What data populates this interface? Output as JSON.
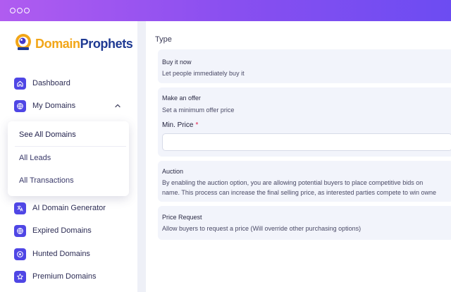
{
  "app": {
    "brand_part1": "Domain",
    "brand_part2": "Prophets"
  },
  "colors": {
    "titlebar_start": "#b05cf0",
    "titlebar_end": "#6c4cf2",
    "accent": "#4f46e5",
    "brand_blue": "#1f3a93",
    "brand_orange": "#f2a618",
    "required": "#e11d48"
  },
  "sidebar": {
    "items": [
      {
        "label": "Dashboard",
        "icon": "home-icon"
      },
      {
        "label": "My Domains",
        "icon": "globe-icon",
        "expanded": true
      },
      {
        "label": "AI Domain Generator",
        "icon": "translate-icon"
      },
      {
        "label": "Expired Domains",
        "icon": "globe-icon"
      },
      {
        "label": "Hunted Domains",
        "icon": "target-icon"
      },
      {
        "label": "Premium Domains",
        "icon": "star-icon"
      }
    ],
    "submenu": [
      {
        "label": "See All Domains",
        "active": true
      },
      {
        "label": "All Leads"
      },
      {
        "label": "All Transactions"
      }
    ]
  },
  "main": {
    "section_title": "Type",
    "options": [
      {
        "title": "Buy it now",
        "desc": "Let people immediately buy it"
      },
      {
        "title": "Make an offer",
        "desc": "Set a minimum offer price"
      },
      {
        "title": "Auction",
        "desc_line1": "By enabling the auction option, you are allowing potential buyers to place competitive bids on",
        "desc_line2": "name. This process can increase the final selling price, as interested parties compete to win owne"
      },
      {
        "title": "Price Request",
        "desc": "Allow buyers to request a price (Will override other purchasing options)"
      }
    ],
    "min_price": {
      "label": "Min. Price",
      "required_mark": "*",
      "value": "",
      "placeholder": ""
    }
  }
}
